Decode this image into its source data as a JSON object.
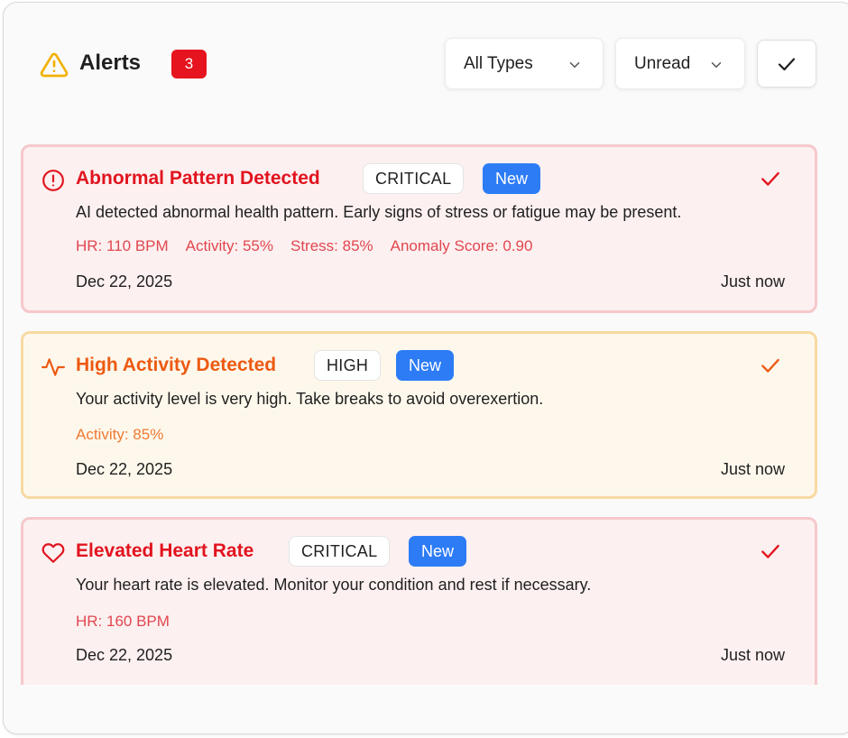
{
  "header": {
    "title": "Alerts",
    "unread_count": "3",
    "type_filter": {
      "selected": "All Types"
    },
    "status_filter": {
      "selected": "Unread"
    },
    "mark_all_icon": "check-icon"
  },
  "colors": {
    "critical_text": "#e1141f",
    "high_text": "#ec5a12",
    "badge_red": "#e6141e",
    "new_blue": "#2d7cf6",
    "warning_yellow": "#f2b203"
  },
  "alerts": [
    {
      "icon": "alert-circle-icon",
      "title": "Abnormal Pattern Detected",
      "severity": "CRITICAL",
      "status": "New",
      "message": "AI detected abnormal health pattern. Early signs of stress or fatigue may be present.",
      "metrics": [
        "HR: 110 BPM",
        "Activity: 55%",
        "Stress: 85%",
        "Anomaly Score: 0.90"
      ],
      "date": "Dec 22, 2025",
      "time": "Just now"
    },
    {
      "icon": "activity-icon",
      "title": "High Activity Detected",
      "severity": "HIGH",
      "status": "New",
      "message": "Your activity level is very high. Take breaks to avoid overexertion.",
      "metrics": [
        "Activity: 85%"
      ],
      "date": "Dec 22, 2025",
      "time": "Just now"
    },
    {
      "icon": "heart-icon",
      "title": "Elevated Heart Rate",
      "severity": "CRITICAL",
      "status": "New",
      "message": "Your heart rate is elevated. Monitor your condition and rest if necessary.",
      "metrics": [
        "HR: 160 BPM"
      ],
      "date": "Dec 22, 2025",
      "time": "Just now"
    }
  ]
}
